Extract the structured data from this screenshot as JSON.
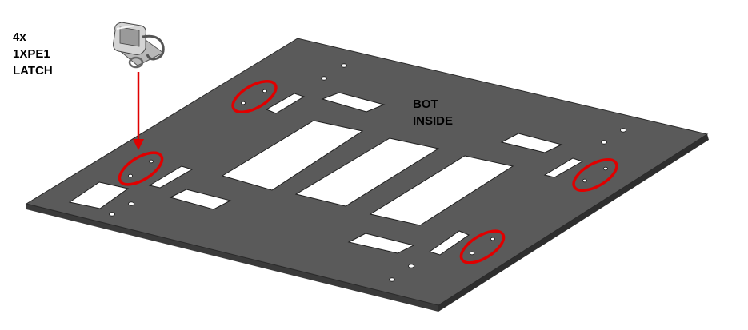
{
  "callout": {
    "lines": [
      "4x",
      "1XPE1",
      "LATCH"
    ]
  },
  "side_label": {
    "lines": [
      "BOT",
      "INSIDE"
    ]
  },
  "colors": {
    "plate_top": "#5a5a5a",
    "plate_edge": "#3a3a3a",
    "highlight": "#e00000",
    "arrow": "#e00000"
  },
  "icons": {
    "latch": "latch-icon"
  }
}
